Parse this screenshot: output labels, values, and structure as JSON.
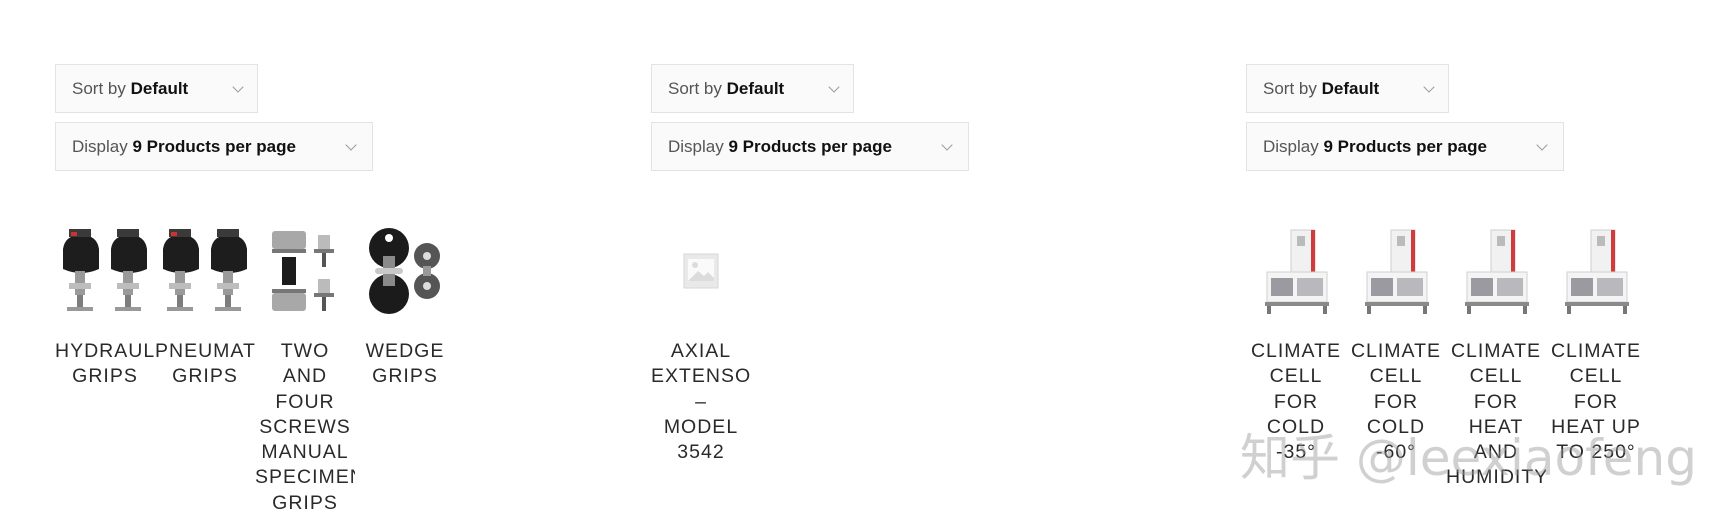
{
  "columns": [
    {
      "sort": {
        "prefix": "Sort by",
        "value": "Default"
      },
      "display": {
        "prefix": "Display",
        "value": "9 Products per page"
      },
      "products": [
        {
          "title_lines": [
            "HYDRAULIC",
            "GRIPS"
          ],
          "image": "hydraulic-grips-image"
        },
        {
          "title_lines": [
            "PNEUMATIC",
            "GRIPS"
          ],
          "image": "pneumatic-grips-image"
        },
        {
          "title_lines": [
            "TWO",
            "AND",
            "FOUR",
            "SCREWS",
            "MANUAL",
            "SPECIMEN",
            "GRIPS"
          ],
          "image": "screw-grips-image"
        },
        {
          "title_lines": [
            "WEDGE",
            "GRIPS"
          ],
          "image": "wedge-grips-image"
        }
      ]
    },
    {
      "sort": {
        "prefix": "Sort by",
        "value": "Default"
      },
      "display": {
        "prefix": "Display",
        "value": "9 Products per page"
      },
      "products": [
        {
          "title_lines": [
            "AXIAL",
            "EXTENSOMETER",
            "–",
            "MODEL",
            "3542"
          ],
          "image": "placeholder-image"
        }
      ]
    },
    {
      "sort": {
        "prefix": "Sort by",
        "value": "Default"
      },
      "display": {
        "prefix": "Display",
        "value": "9 Products per page"
      },
      "products": [
        {
          "title_lines": [
            "CLIMATE",
            "CELL",
            "FOR",
            "COLD",
            "-35°"
          ],
          "image": "climate-cell-image"
        },
        {
          "title_lines": [
            "CLIMATE",
            "CELL",
            "FOR",
            "COLD",
            "-60°"
          ],
          "image": "climate-cell-image"
        },
        {
          "title_lines": [
            "CLIMATE",
            "CELL",
            "FOR",
            "HEAT",
            "AND",
            "HUMIDITY"
          ],
          "image": "climate-cell-image"
        },
        {
          "title_lines": [
            "CLIMATE",
            "CELL",
            "FOR",
            "HEAT UP",
            "TO 250°"
          ],
          "image": "climate-cell-image"
        }
      ]
    }
  ],
  "watermark": "知乎 @leexiaofeng"
}
